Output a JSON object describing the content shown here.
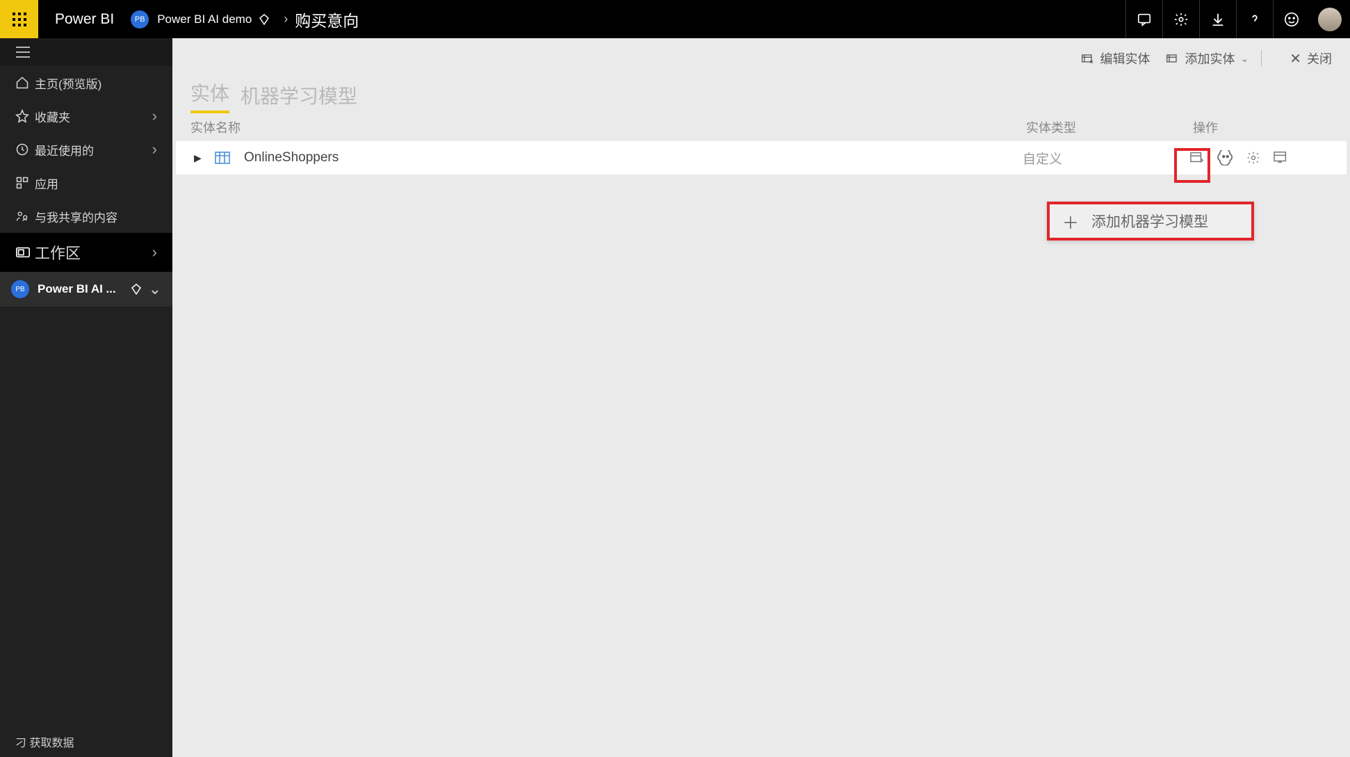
{
  "header": {
    "brand": "Power BI",
    "workspace_badge": "PB",
    "workspace_name": "Power BI AI demo",
    "breadcrumb_current": "购买意向"
  },
  "sidebar": {
    "items": [
      {
        "icon": "home",
        "label": "主页(预览版)",
        "chev": false
      },
      {
        "icon": "star",
        "label": "收藏夹",
        "chev": true
      },
      {
        "icon": "clock",
        "label": "最近使用的",
        "chev": true
      },
      {
        "icon": "app",
        "label": "应用",
        "chev": false
      },
      {
        "icon": "share",
        "label": "与我共享的内容",
        "chev": false
      }
    ],
    "workspace_label": "工作区",
    "workspace_row": {
      "badge": "PB",
      "name": "Power BI AI ..."
    },
    "footer": "刁 获取数据"
  },
  "toolbar": {
    "edit_entity": "编辑实体",
    "add_entity": "添加实体",
    "close": "关闭"
  },
  "tabs": {
    "entities": "实体",
    "ml_models": "机器学习模型"
  },
  "columns": {
    "name": "实体名称",
    "type": "实体类型",
    "ops": "操作"
  },
  "entity_row": {
    "name": "OnlineShoppers",
    "type": "自定义"
  },
  "popup": {
    "label": "添加机器学习模型"
  }
}
